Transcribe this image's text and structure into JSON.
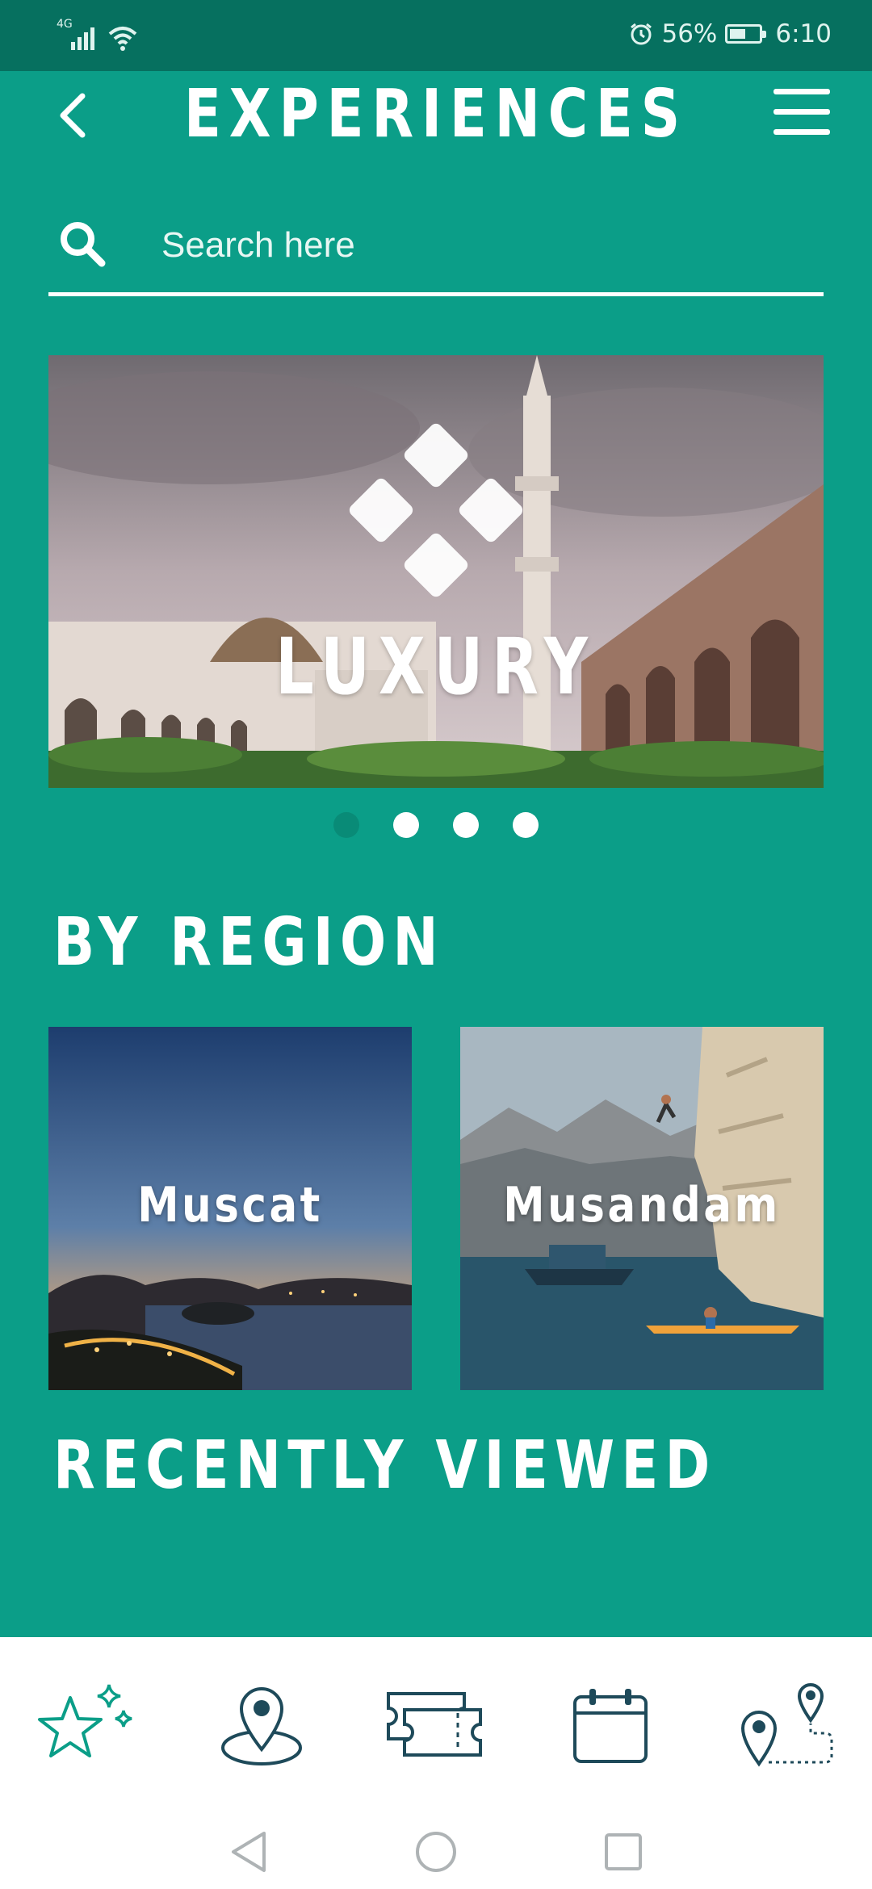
{
  "status_bar": {
    "network": "4G",
    "battery_level": 0.56,
    "battery_percent": "56%",
    "time": "6:10"
  },
  "header": {
    "title": "EXPERIENCES"
  },
  "search": {
    "placeholder": "Search here"
  },
  "carousel": {
    "current_slide_label": "LUXURY",
    "slide_count": 4,
    "active_index": 0
  },
  "by_region": {
    "title": "BY REGION",
    "regions": [
      {
        "label": "Muscat"
      },
      {
        "label": "Musandam"
      }
    ]
  },
  "recently_viewed": {
    "title": "RECENTLY VIEWED"
  },
  "bottom_nav": {
    "items": [
      {
        "icon": "stars-icon",
        "active": true
      },
      {
        "icon": "map-pin-icon",
        "active": false
      },
      {
        "icon": "tickets-icon",
        "active": false
      },
      {
        "icon": "calendar-icon",
        "active": false
      },
      {
        "icon": "route-icon",
        "active": false
      }
    ]
  },
  "colors": {
    "background": "#0b9e88",
    "status_bar": "#06705f",
    "nav_accent": "#0b9e88",
    "nav_inactive": "#1e4a5a"
  }
}
